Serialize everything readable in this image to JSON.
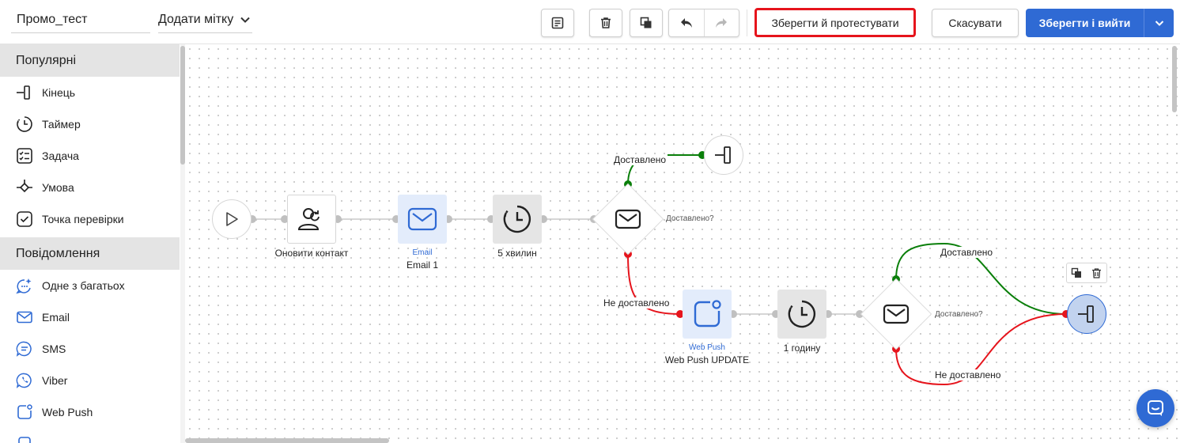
{
  "toolbar": {
    "name_value": "Промо_тест",
    "add_tag_label": "Додати мітку",
    "test_label": "Зберегти й протестувати",
    "cancel_label": "Скасувати",
    "save_exit_label": "Зберегти і вийти"
  },
  "sidebar": {
    "sections": [
      {
        "title": "Популярні",
        "items": [
          {
            "label": "Кінець",
            "icon": "end-icon"
          },
          {
            "label": "Таймер",
            "icon": "timer-icon"
          },
          {
            "label": "Задача",
            "icon": "task-icon"
          },
          {
            "label": "Умова",
            "icon": "condition-icon"
          },
          {
            "label": "Точка перевірки",
            "icon": "checkpoint-icon"
          }
        ]
      },
      {
        "title": "Повідомлення",
        "items": [
          {
            "label": "Одне з багатьох",
            "icon": "sparkle-chat-icon"
          },
          {
            "label": "Email",
            "icon": "email-icon"
          },
          {
            "label": "SMS",
            "icon": "sms-icon"
          },
          {
            "label": "Viber",
            "icon": "viber-icon"
          },
          {
            "label": "Web Push",
            "icon": "webpush-icon"
          }
        ]
      }
    ]
  },
  "flow": {
    "update_contact": "Оновити контакт",
    "email_type": "Email",
    "email_name": "Email 1",
    "timer1": "5 хвилин",
    "check1_question": "Доставлено?",
    "delivered_1": "Доставлено",
    "not_delivered_1": "Не доставлено",
    "webpush_type": "Web Push",
    "webpush_name": "Web Push UPDATE",
    "timer2": "1 годину",
    "check2_question": "Доставлено?",
    "delivered_2": "Доставлено",
    "not_delivered_2": "Не доставлено"
  },
  "colors": {
    "accent": "#2f6ad4",
    "delivered": "#0a7f0a",
    "not_delivered": "#e6141c"
  }
}
